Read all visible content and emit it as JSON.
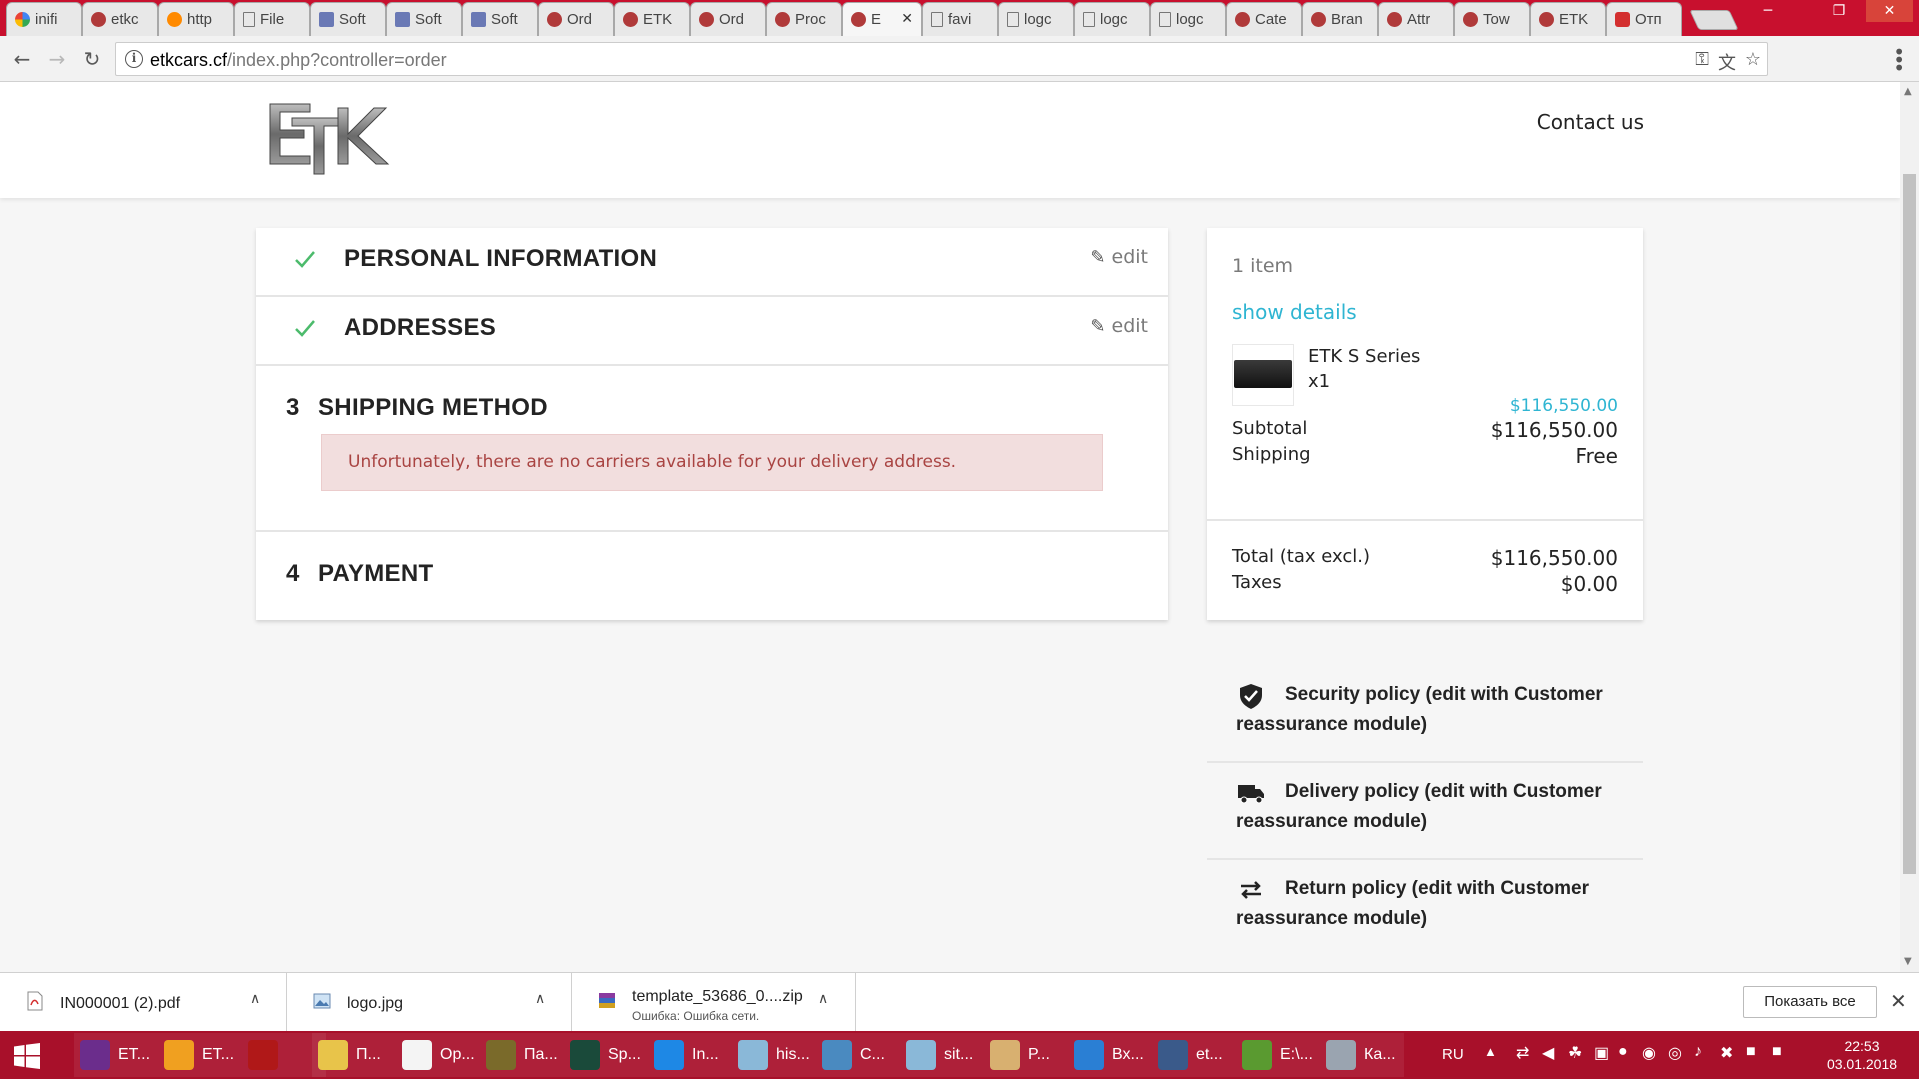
{
  "browser": {
    "tabs": [
      {
        "title": "inifi",
        "icon": "google-icon"
      },
      {
        "title": "etkc",
        "icon": "etk-icon"
      },
      {
        "title": "http",
        "icon": "ol-icon"
      },
      {
        "title": "File",
        "icon": "file-icon"
      },
      {
        "title": "Soft",
        "icon": "pen-icon"
      },
      {
        "title": "Soft",
        "icon": "pen-icon"
      },
      {
        "title": "Soft",
        "icon": "pen-icon"
      },
      {
        "title": "Ord",
        "icon": "etk-icon"
      },
      {
        "title": "ETK",
        "icon": "etk-icon"
      },
      {
        "title": "Ord",
        "icon": "etk-icon"
      },
      {
        "title": "Proc",
        "icon": "spinner-icon"
      },
      {
        "title": "E",
        "icon": "etk-icon",
        "active": true
      },
      {
        "title": "favi",
        "icon": "doc-icon"
      },
      {
        "title": "logc",
        "icon": "doc-icon"
      },
      {
        "title": "logc",
        "icon": "doc-icon"
      },
      {
        "title": "logc",
        "icon": "doc-icon"
      },
      {
        "title": "Cate",
        "icon": "etk-icon"
      },
      {
        "title": "Bran",
        "icon": "etk-icon"
      },
      {
        "title": "Attr",
        "icon": "etk-icon"
      },
      {
        "title": "Tow",
        "icon": "etk-icon"
      },
      {
        "title": "ETK",
        "icon": "etk-icon"
      },
      {
        "title": "Отп",
        "icon": "red-icon"
      }
    ],
    "url_host": "etkcars.cf",
    "url_path": "/index.php?controller=order"
  },
  "header": {
    "logo_text": "ETK",
    "contact": "Contact us"
  },
  "checkout": {
    "steps": [
      {
        "title": "PERSONAL INFORMATION",
        "edit": "edit",
        "status": "complete"
      },
      {
        "title": "ADDRESSES",
        "edit": "edit",
        "status": "complete"
      },
      {
        "number": "3",
        "title": "SHIPPING METHOD",
        "status": "current",
        "alert": "Unfortunately, there are no carriers available for your delivery address."
      },
      {
        "number": "4",
        "title": "PAYMENT",
        "status": "pending"
      }
    ]
  },
  "cart": {
    "count": "1 item",
    "show_details": "show details",
    "product": {
      "name": "ETK S Series",
      "qty": "x1",
      "price": "$116,550.00"
    },
    "subtotal_label": "Subtotal",
    "subtotal_value": "$116,550.00",
    "shipping_label": "Shipping",
    "shipping_value": "Free",
    "total_label": "Total (tax excl.)",
    "total_value": "$116,550.00",
    "taxes_label": "Taxes",
    "taxes_value": "$0.00"
  },
  "reassurance": [
    {
      "icon": "shield-icon",
      "text": "Security policy (edit with Customer reassurance module)"
    },
    {
      "icon": "truck-icon",
      "text": "Delivery policy (edit with Customer reassurance module)"
    },
    {
      "icon": "exchange-icon",
      "text": "Return policy (edit with Customer reassurance module)"
    }
  ],
  "downloads": {
    "items": [
      {
        "name": "IN000001 (2).pdf",
        "icon": "pdf-icon"
      },
      {
        "name": "logo.jpg",
        "icon": "image-icon"
      },
      {
        "name": "template_53686_0....zip",
        "status": "Ошибка: Ошибка сети.",
        "icon": "archive-icon"
      }
    ],
    "show_all": "Показать все"
  },
  "taskbar": {
    "apps": [
      {
        "label": "ET...",
        "color": "#6b2d8c"
      },
      {
        "label": "ET...",
        "color": "#f0a020"
      },
      {
        "label": "",
        "color": "#b01818"
      },
      {
        "label": "П...",
        "color": "#e8c44a"
      },
      {
        "label": "Op...",
        "color": "#f4f4f4"
      },
      {
        "label": "Па...",
        "color": "#7a6a2a"
      },
      {
        "label": "Sp...",
        "color": "#1a4a3a"
      },
      {
        "label": "In...",
        "color": "#1e88e5"
      },
      {
        "label": "his...",
        "color": "#8ab8d8"
      },
      {
        "label": "C...",
        "color": "#4a8ac0"
      },
      {
        "label": "sit...",
        "color": "#8ab8d8"
      },
      {
        "label": "P...",
        "color": "#d8b070"
      },
      {
        "label": "Вх...",
        "color": "#2a7fd4"
      },
      {
        "label": "et...",
        "color": "#3a5a8a"
      },
      {
        "label": "E:\\...",
        "color": "#5a9a30"
      },
      {
        "label": "Ка...",
        "color": "#9aa4b0"
      }
    ],
    "lang": "RU",
    "time": "22:53",
    "date": "03.01.2018"
  },
  "colors": {
    "accent": "#2fb5d2",
    "check": "#4cbb6c",
    "alert_bg": "#f2dede",
    "alert_text": "#a94442",
    "chrome_frame": "#c8102e",
    "taskbar": "#a8102a"
  }
}
